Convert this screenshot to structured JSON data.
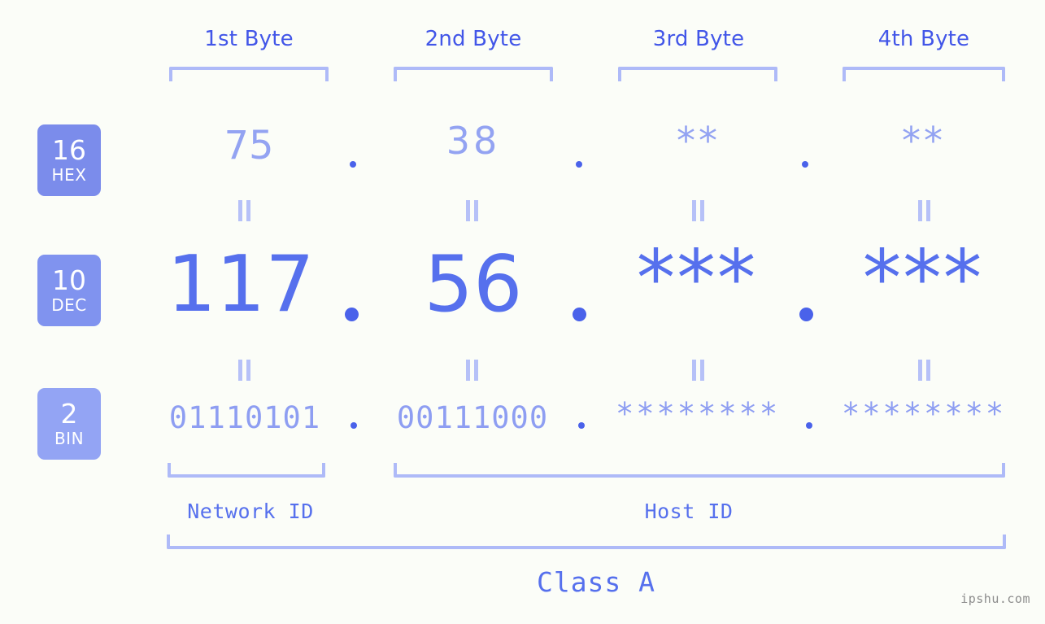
{
  "background_color": "#fbfdf8",
  "accent_colors": {
    "strong_blue": "#4256e8",
    "value_blue": "#5670ed",
    "light_periwinkle": "#93a3f2",
    "bracket": "#aebaf8",
    "badge_hex": "#7b8ceb",
    "badge_dec": "#8093ef",
    "badge_bin": "#93a4f4",
    "watermark_gray": "#8c8c8c"
  },
  "headers": [
    {
      "label": "1st Byte"
    },
    {
      "label": "2nd Byte"
    },
    {
      "label": "3rd Byte"
    },
    {
      "label": "4th Byte"
    }
  ],
  "radix_badges": [
    {
      "number": "16",
      "system": "HEX"
    },
    {
      "number": "10",
      "system": "DEC"
    },
    {
      "number": "2",
      "system": "BIN"
    }
  ],
  "rows": {
    "hex": {
      "radix": "16",
      "system": "HEX",
      "values": [
        "75",
        "38",
        "**",
        "**"
      ],
      "separator": "."
    },
    "dec": {
      "radix": "10",
      "system": "DEC",
      "values": [
        "117",
        "56",
        "***",
        "***"
      ],
      "separator": "."
    },
    "bin": {
      "radix": "2",
      "system": "BIN",
      "values": [
        "01110101",
        "00111000",
        "********",
        "********"
      ],
      "separator": "."
    }
  },
  "equals_glyph": "=",
  "regions": [
    {
      "label": "Network ID"
    },
    {
      "label": "Host ID"
    }
  ],
  "class_label": "Class A",
  "watermark": "ipshu.com"
}
